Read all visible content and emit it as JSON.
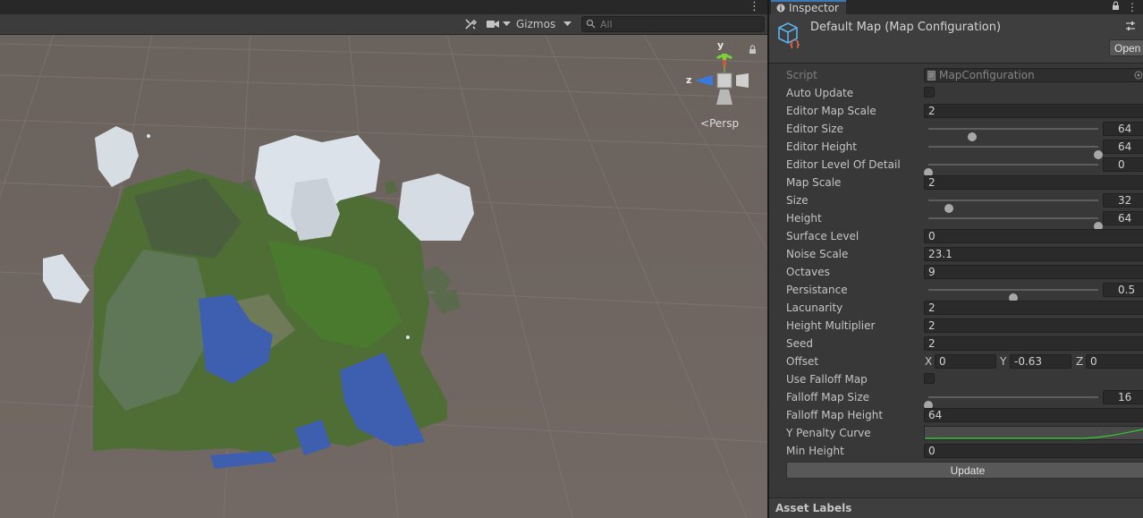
{
  "scene": {
    "toolbar": {
      "gizmos_label": "Gizmos",
      "search_placeholder": "All"
    },
    "gizmo": {
      "axis_y": "y",
      "axis_z": "z",
      "projection_label": "Persp"
    }
  },
  "inspector": {
    "tab_label": "Inspector",
    "asset_title": "Default Map (Map Configuration)",
    "open_button": "Open",
    "properties": {
      "script": {
        "label": "Script",
        "value": "MapConfiguration"
      },
      "auto_update": {
        "label": "Auto Update",
        "checked": false
      },
      "editor_map_scale": {
        "label": "Editor Map Scale",
        "value": "2"
      },
      "editor_size": {
        "label": "Editor Size",
        "value": "64",
        "fraction": 0.26
      },
      "editor_height": {
        "label": "Editor Height",
        "value": "64",
        "fraction": 1.0
      },
      "editor_lod": {
        "label": "Editor Level Of Detail",
        "value": "0",
        "fraction": 0.0
      },
      "map_scale": {
        "label": "Map Scale",
        "value": "2"
      },
      "size": {
        "label": "Size",
        "value": "32",
        "fraction": 0.12
      },
      "height": {
        "label": "Height",
        "value": "64",
        "fraction": 1.0
      },
      "surface_level": {
        "label": "Surface Level",
        "value": "0"
      },
      "noise_scale": {
        "label": "Noise Scale",
        "value": "23.1"
      },
      "octaves": {
        "label": "Octaves",
        "value": "9"
      },
      "persistance": {
        "label": "Persistance",
        "value": "0.5",
        "fraction": 0.5
      },
      "lacunarity": {
        "label": "Lacunarity",
        "value": "2"
      },
      "height_multiplier": {
        "label": "Height Multiplier",
        "value": "2"
      },
      "seed": {
        "label": "Seed",
        "value": "2"
      },
      "offset": {
        "label": "Offset",
        "x_label": "X",
        "x": "0",
        "y_label": "Y",
        "y": "-0.63",
        "z_label": "Z",
        "z": "0"
      },
      "use_falloff_map": {
        "label": "Use Falloff Map",
        "checked": false
      },
      "falloff_map_size": {
        "label": "Falloff Map Size",
        "value": "16",
        "fraction": 0.0
      },
      "falloff_map_height": {
        "label": "Falloff Map Height",
        "value": "64"
      },
      "y_penalty_curve": {
        "label": "Y Penalty Curve"
      },
      "min_height": {
        "label": "Min Height",
        "value": "0"
      }
    },
    "update_button": "Update",
    "asset_labels": "Asset Labels"
  },
  "colors": {
    "scene_background": "#6e6560",
    "panel_background": "#383838",
    "field_background": "#2a2a2a",
    "accent_tab": "#3a79bb",
    "curve_line": "#2fd12f",
    "axis_y": "#7ad33a",
    "axis_z": "#3a7ae0",
    "axis_x": "#e24a3a"
  }
}
